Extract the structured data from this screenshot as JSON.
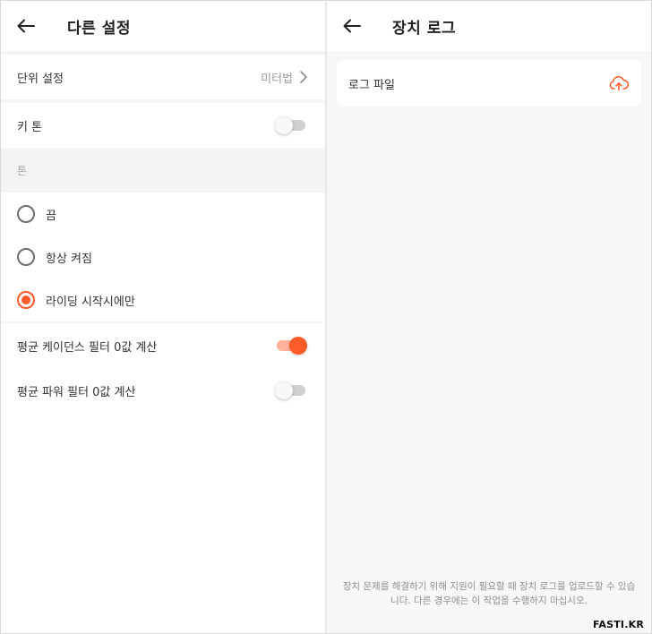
{
  "left": {
    "title": "다른 설정",
    "unit_setting": {
      "label": "단위 설정",
      "value": "미터법"
    },
    "key_tone": {
      "label": "키 톤",
      "on": false
    },
    "tone_section": {
      "header": "톤",
      "options": [
        {
          "label": "끔",
          "selected": false
        },
        {
          "label": "항상 켜짐",
          "selected": false
        },
        {
          "label": "라이딩 시작시에만",
          "selected": true
        }
      ]
    },
    "avg_cadence": {
      "label": "평균 케이던스 필터 0값 계산",
      "on": true
    },
    "avg_power": {
      "label": "평균 파워 필터 0값 계산",
      "on": false
    }
  },
  "right": {
    "title": "장치 로그",
    "log_file": {
      "label": "로그 파일",
      "icon": "cloud-upload-icon"
    },
    "footer_note": "장치 문제를 해결하기 위해 지원이 필요할 때 장치 로그를 업로드할 수 있습니다. 다른 경우에는 이 작업을 수행하지 마십시오."
  },
  "watermark": "FASTI.KR",
  "colors": {
    "accent": "#ff5a2a",
    "accent_light": "#ffb199",
    "toggle_off": "#d0d0d0"
  }
}
